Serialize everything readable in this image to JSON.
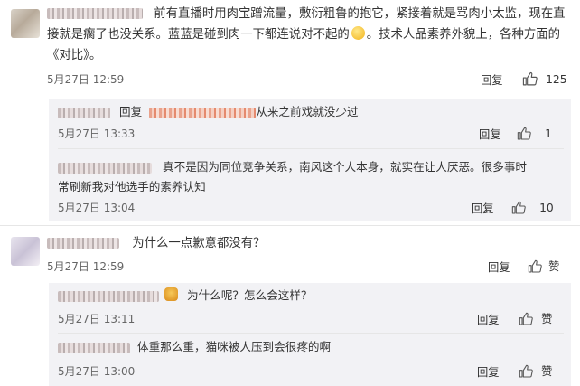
{
  "comments": [
    {
      "text_line1": "前有直播时用肉宝蹭流量，敷衍粗鲁的抱它，紧接着就是骂肉小太监，现在直",
      "text_line2a": "接就是瘸了也没关系。蓝蓝是碰到肉一下都连说对不起的",
      "text_line2b": "。技术人品素养外貌上，各种方面的",
      "text_line3": "《对比》。",
      "time": "5月27日 12:59",
      "reply_label": "回复",
      "likes": "125",
      "replies": [
        {
          "prefix": "回复",
          "text": "从来之前戏就没少过",
          "time": "5月27日 13:33",
          "reply_label": "回复",
          "likes": "1"
        },
        {
          "text_line1": "真不是因为同位竞争关系，南风这个人本身，就实在让人厌恶。很多事时",
          "text_line2": "常刷新我对他选手的素养认知",
          "time": "5月27日 13:04",
          "reply_label": "回复",
          "likes": "10"
        }
      ]
    },
    {
      "text": "为什么一点歉意都没有？",
      "time": "5月27日 12:59",
      "reply_label": "回复",
      "likes": "赞",
      "replies": [
        {
          "text": "为什么呢？怎么会这样？",
          "time": "5月27日 13:11",
          "reply_label": "回复",
          "likes": "赞"
        },
        {
          "text": "体重那么重，猫咪被人压到会很疼的啊",
          "time": "5月27日 13:00",
          "reply_label": "回复",
          "likes": "赞"
        }
      ]
    }
  ]
}
